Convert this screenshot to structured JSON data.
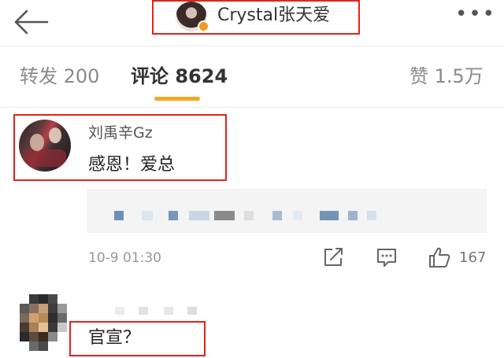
{
  "header": {
    "title": "Crystal张天爱",
    "back_icon": "arrow-left-icon",
    "more_icon": "more-dots-icon",
    "more_glyph": "•••",
    "badge_color": "#f39a1c"
  },
  "tabs": [
    {
      "label": "转发 200",
      "active": false
    },
    {
      "label": "评论 8624",
      "active": true
    },
    {
      "label": "赞 1.5万",
      "active": false
    }
  ],
  "accent_color": "#f5a623",
  "highlight_color": "#e1241c",
  "comments": [
    {
      "author": "刘禹辛Gz",
      "text": "感恩！爱总",
      "time": "10-9 01:30",
      "like_count": "167",
      "actions": [
        "repost-icon",
        "comment-icon",
        "like-icon"
      ]
    },
    {
      "text": "官宣？"
    }
  ]
}
